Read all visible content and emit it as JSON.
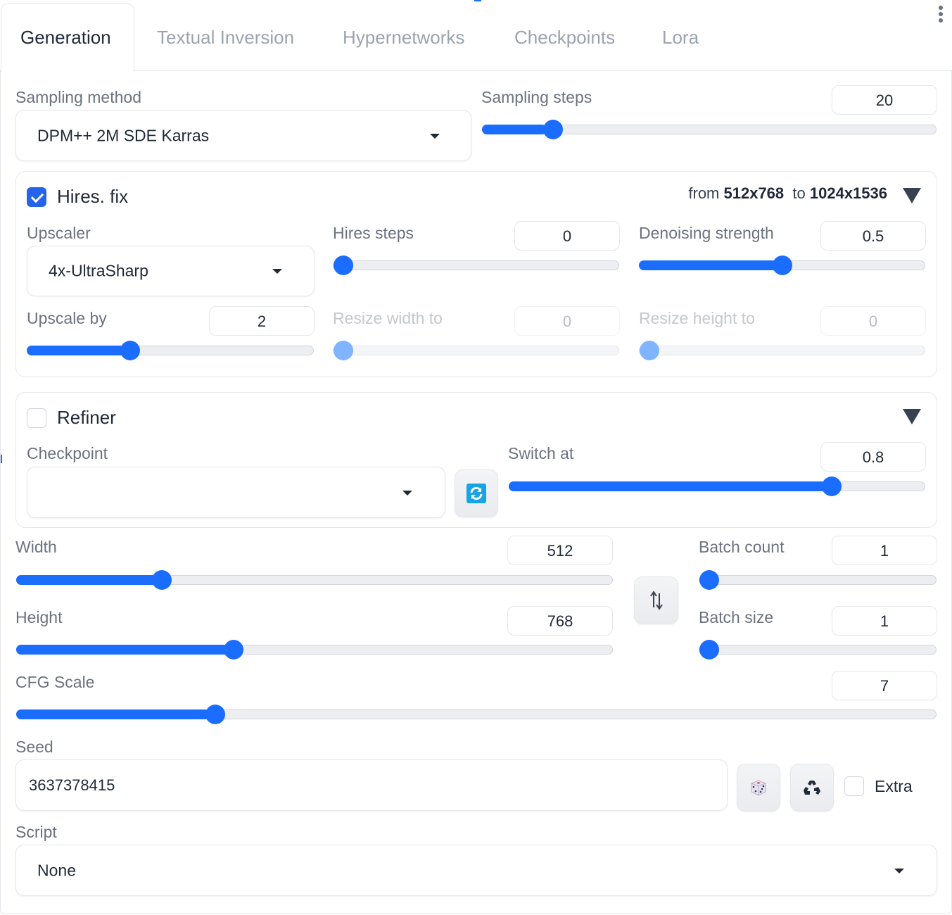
{
  "tabs": [
    {
      "label": "Generation",
      "active": true
    },
    {
      "label": "Textual Inversion",
      "active": false
    },
    {
      "label": "Hypernetworks",
      "active": false
    },
    {
      "label": "Checkpoints",
      "active": false
    },
    {
      "label": "Lora",
      "active": false
    }
  ],
  "menu_icon": "kebab-menu-icon",
  "accent_color": "#1a6dff",
  "sampling_method": {
    "label": "Sampling method",
    "value": "DPM++ 2M SDE Karras"
  },
  "sampling_steps": {
    "label": "Sampling steps",
    "value": "20",
    "fraction": 0.14
  },
  "hires_fix": {
    "label": "Hires. fix",
    "checked": true,
    "info_from": "from",
    "info_from_size": "512x768",
    "info_to": "to",
    "info_to_size": "1024x1536",
    "upscaler": {
      "label": "Upscaler",
      "value": "4x-UltraSharp"
    },
    "hires_steps": {
      "label": "Hires steps",
      "value": "0",
      "fraction": 0.0
    },
    "denoising_strength": {
      "label": "Denoising strength",
      "value": "0.5",
      "fraction": 0.5
    },
    "upscale_by": {
      "label": "Upscale by",
      "value": "2",
      "fraction": 0.35
    },
    "resize_width": {
      "label": "Resize width to",
      "value": "0",
      "fraction": 0.0
    },
    "resize_height": {
      "label": "Resize height to",
      "value": "0",
      "fraction": 0.0
    }
  },
  "refiner": {
    "label": "Refiner",
    "checked": false,
    "checkpoint": {
      "label": "Checkpoint",
      "value": ""
    },
    "refresh_icon": "refresh-icon",
    "switch_at": {
      "label": "Switch at",
      "value": "0.8",
      "fraction": 0.79
    }
  },
  "width": {
    "label": "Width",
    "value": "512",
    "fraction": 0.235
  },
  "height": {
    "label": "Height",
    "value": "768",
    "fraction": 0.36
  },
  "swap_icon": "swap-dimensions-icon",
  "batch_count": {
    "label": "Batch count",
    "value": "1",
    "fraction": 0.0
  },
  "batch_size": {
    "label": "Batch size",
    "value": "1",
    "fraction": 0.0
  },
  "cfg_scale": {
    "label": "CFG Scale",
    "value": "7",
    "fraction": 0.21
  },
  "seed": {
    "label": "Seed",
    "value": "3637378415",
    "random_icon": "dice-icon",
    "reuse_icon": "recycle-icon",
    "extra_label": "Extra",
    "extra_checked": false
  },
  "script": {
    "label": "Script",
    "value": "None"
  }
}
